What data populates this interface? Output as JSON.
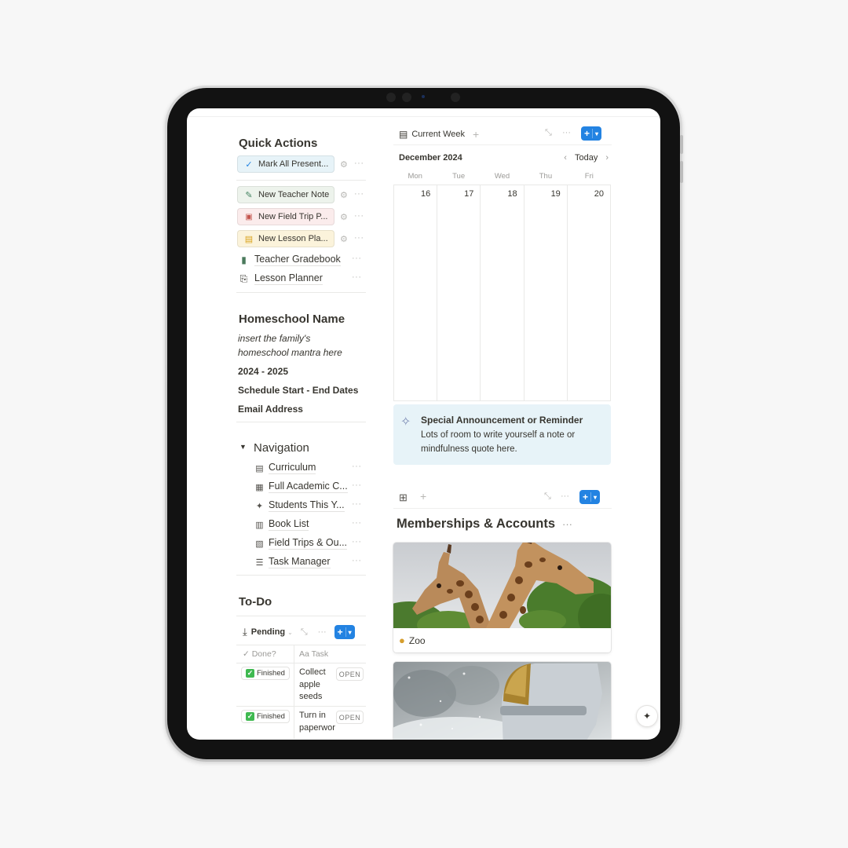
{
  "quick_actions": {
    "title": "Quick Actions",
    "buttons": [
      {
        "label": "Mark All Present...",
        "icon": "check-icon",
        "glyph": "✓",
        "bg": "#e7f3f8",
        "icon_color": "#2383e2"
      },
      {
        "label": "New Teacher Note",
        "icon": "pencil-icon",
        "glyph": "✎",
        "bg": "#edf3ec",
        "icon_color": "#448361"
      },
      {
        "label": "New Field Trip P...",
        "icon": "bus-icon",
        "glyph": "🚌",
        "bg": "#fbecec",
        "icon_color": "#c4554d"
      },
      {
        "label": "New Lesson Pla...",
        "icon": "notebook-icon",
        "glyph": "▤",
        "bg": "#fbf3db",
        "icon_color": "#d9a21b"
      }
    ],
    "links": [
      {
        "label": "Teacher Gradebook",
        "icon": "gradebook-icon",
        "glyph": "▮"
      },
      {
        "label": "Lesson Planner",
        "icon": "planner-icon",
        "glyph": "⎘"
      }
    ],
    "more": "···",
    "gear": "⚙"
  },
  "homeschool": {
    "title": "Homeschool Name",
    "mantra_line1": "insert the family's",
    "mantra_line2": "homeschool mantra here",
    "year": "2024 - 2025",
    "schedule": "Schedule Start - End Dates",
    "email": "Email Address"
  },
  "navigation": {
    "title": "Navigation",
    "toggle": "▼",
    "items": [
      {
        "label": "Curriculum",
        "icon": "document-icon",
        "glyph": "▤"
      },
      {
        "label": "Full Academic C...",
        "icon": "calendar-icon",
        "glyph": "▦"
      },
      {
        "label": "Students This Y...",
        "icon": "students-icon",
        "glyph": "✦"
      },
      {
        "label": "Book List",
        "icon": "books-icon",
        "glyph": "▥"
      },
      {
        "label": "Field Trips & Ou...",
        "icon": "field-trip-icon",
        "glyph": "▧"
      },
      {
        "label": "Task Manager",
        "icon": "list-icon",
        "glyph": "☰"
      }
    ]
  },
  "todo": {
    "title": "To-Do",
    "view_label": "Pending",
    "col_done": "Done?",
    "col_task": "Aa Task",
    "rows": [
      {
        "status": "Finished",
        "task": "Collect apple seeds",
        "open": "OPEN"
      },
      {
        "status": "Finished",
        "task": "Turn in paperwor",
        "open": "OPEN"
      }
    ]
  },
  "calendar": {
    "view_label": "Current Week",
    "month": "December 2024",
    "today_label": "Today",
    "days": [
      "Mon",
      "Tue",
      "Wed",
      "Thu",
      "Fri"
    ],
    "dates": [
      "16",
      "17",
      "18",
      "19",
      "20"
    ]
  },
  "callout": {
    "title": "Special Announcement or Reminder",
    "body": "Lots of room to write yourself a note or mindfulness quote here."
  },
  "gallery": {
    "title": "Memberships & Accounts",
    "cards": [
      {
        "label": "Zoo",
        "icon": "elephant-icon",
        "image": "giraffes"
      },
      {
        "label": "",
        "image": "astronaut"
      }
    ]
  },
  "colors": {
    "accent": "#2383e2",
    "callout_bg": "#e7f3f8"
  }
}
